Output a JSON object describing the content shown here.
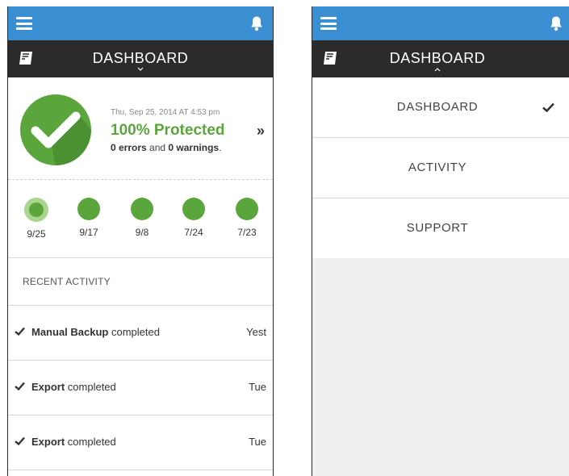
{
  "screens": {
    "left": {
      "header_title": "DASHBOARD",
      "status": {
        "date": "Thu, Sep 25, 2014 AT 4:53 pm",
        "title": "100% Protected",
        "errors": "0 errors",
        "and_text": " and ",
        "warnings": "0 warnings",
        "period": "."
      },
      "chevron": "»",
      "history": [
        {
          "label": "9/25",
          "selected": true
        },
        {
          "label": "9/17",
          "selected": false
        },
        {
          "label": "9/8",
          "selected": false
        },
        {
          "label": "7/24",
          "selected": false
        },
        {
          "label": "7/23",
          "selected": false
        }
      ],
      "recent_heading": "RECENT ACTIVITY",
      "activity": [
        {
          "bold": "Manual Backup",
          "rest": " completed",
          "time": "Yest"
        },
        {
          "bold": "Export",
          "rest": " completed",
          "time": "Tue"
        },
        {
          "bold": "Export",
          "rest": " completed",
          "time": "Tue"
        }
      ]
    },
    "right": {
      "header_title": "DASHBOARD",
      "menu": [
        {
          "label": "DASHBOARD",
          "checked": true
        },
        {
          "label": "ACTIVITY",
          "checked": false
        },
        {
          "label": "SUPPORT",
          "checked": false
        }
      ]
    }
  },
  "colors": {
    "topbar": "#3a8fd3",
    "headerbar": "#2b2b2b",
    "success_green": "#5aa63c",
    "menu_background": "#eeeff1"
  },
  "icons": {
    "menu": "hamburger-menu-icon",
    "notifications": "bell-icon",
    "logo": "app-logo-icon",
    "status": "checkmark-circle-icon",
    "activity": "checkmark-icon"
  }
}
